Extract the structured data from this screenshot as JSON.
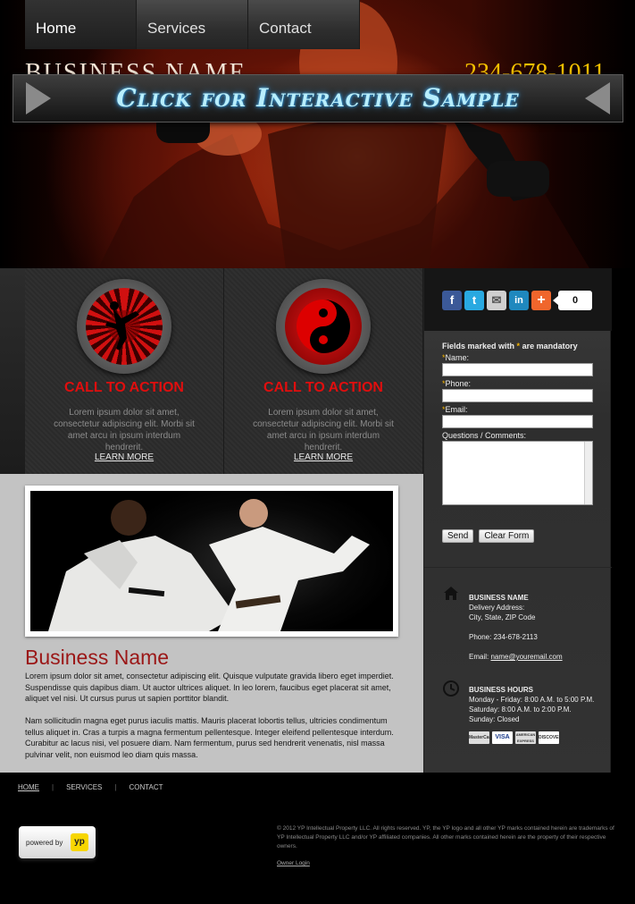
{
  "nav": {
    "tabs": [
      {
        "label": "Home"
      },
      {
        "label": "Services"
      },
      {
        "label": "Contact"
      }
    ]
  },
  "hero": {
    "business_name": "BUSINESS NAME",
    "phone": "234-678-1011",
    "banner_text": "Click for Interactive Sample"
  },
  "actions": [
    {
      "title": "CALL TO ACTION",
      "text": "Lorem ipsum dolor sit amet, consectetur adipiscing elit. Morbi sit amet arcu in ipsum interdum hendrerit.",
      "link": "LEARN MORE"
    },
    {
      "title": "CALL TO ACTION",
      "text": "Lorem ipsum dolor sit amet, consectetur adipiscing elit. Morbi sit amet arcu in ipsum interdum hendrerit.",
      "link": "LEARN MORE"
    }
  ],
  "main": {
    "title": "Business Name",
    "p1": "Lorem ipsum dolor sit amet, consectetur adipiscing elit. Quisque vulputate gravida libero eget imperdiet. Suspendisse quis dapibus diam. Ut auctor ultrices aliquet. In leo lorem, faucibus eget placerat sit amet, aliquet vel nisi. Ut cursus purus ut sapien porttitor blandit.",
    "p2": "Nam sollicitudin magna eget purus iaculis mattis. Mauris placerat lobortis tellus, ultricies condimentum tellus aliquet in. Cras a turpis a magna fermentum pellentesque. Integer eleifend pellentesque interdum. Curabitur ac lacus nisi, vel posuere diam. Nam fermentum, purus sed hendrerit venenatis, nisl massa pulvinar velit, non euismod leo diam quis massa."
  },
  "share": {
    "count": "0",
    "buttons": [
      "f",
      "t",
      "✉",
      "in",
      "+"
    ]
  },
  "form": {
    "header_prefix": "Fields marked with",
    "header_star": "*",
    "header_suffix": "are mandatory",
    "fields": [
      {
        "label": "Name:"
      },
      {
        "label": "Phone:"
      },
      {
        "label": "Email:"
      }
    ],
    "comments_label": "Questions / Comments:",
    "send": "Send",
    "clear": "Clear Form"
  },
  "contact": {
    "name": "BUSINESS NAME",
    "addr1": "Delivery Address:",
    "addr2": "City, State, ZIP Code",
    "phone": "Phone: 234-678-2113",
    "email_prefix": "Email:",
    "email": "name@youremail.com"
  },
  "hours": {
    "title": "BUSINESS HOURS",
    "l1": "Monday - Friday: 8:00 A.M. to 5:00 P.M.",
    "l2": "Saturday: 8:00 A.M. to 2:00 P.M.",
    "l3": "Sunday: Closed"
  },
  "payments": [
    "MasterCard",
    "VISA",
    "AMERICAN EXPRESS",
    "DISCOVER"
  ],
  "footer": {
    "links": [
      "HOME",
      "SERVICES",
      "CONTACT"
    ],
    "separator": "|",
    "powered_by": "powered by",
    "yp": "yp",
    "legal": "© 2012 YP Intellectual Property LLC. All rights reserved. YP, the YP logo and all other YP marks contained herein are trademarks of YP Intellectual Property LLC and/or YP affiliated companies. All other marks contained herein are the property of their respective owners.",
    "owner_login": "Owner Login"
  },
  "colors": {
    "accent_red": "#e00e0e",
    "title_red": "#9b1717",
    "banner_glow": "#b8eefc",
    "phone_gold": "#f4c000"
  }
}
